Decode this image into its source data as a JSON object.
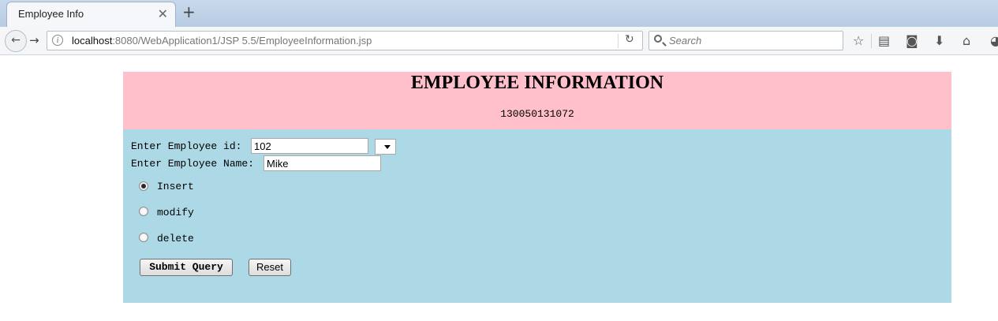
{
  "browser": {
    "tab_title": "Employee Info",
    "url_host": "localhost",
    "url_rest": ":8080/WebApplication1/JSP 5.5/EmployeeInformation.jsp",
    "search_placeholder": "Search",
    "toolbar_icons": [
      "back-icon",
      "forward-icon",
      "info-icon",
      "reload-icon",
      "search-icon",
      "bookmark-star-icon",
      "reading-list-icon",
      "pocket-icon",
      "download-icon",
      "home-icon",
      "chat-icon"
    ]
  },
  "header": {
    "title": "EMPLOYEE INFORMATION",
    "enrollment": "130050131072",
    "bg_color": "#ffc0cb"
  },
  "form": {
    "bg_color": "#add8e6",
    "id_label": "Enter Employee id:",
    "id_value": "102",
    "name_label": "Enter Employee Name:",
    "name_value": "Mike",
    "options": [
      {
        "label": "Insert",
        "checked": true
      },
      {
        "label": "modify",
        "checked": false
      },
      {
        "label": "delete",
        "checked": false
      }
    ],
    "submit_label": "Submit Query",
    "reset_label": "Reset"
  }
}
